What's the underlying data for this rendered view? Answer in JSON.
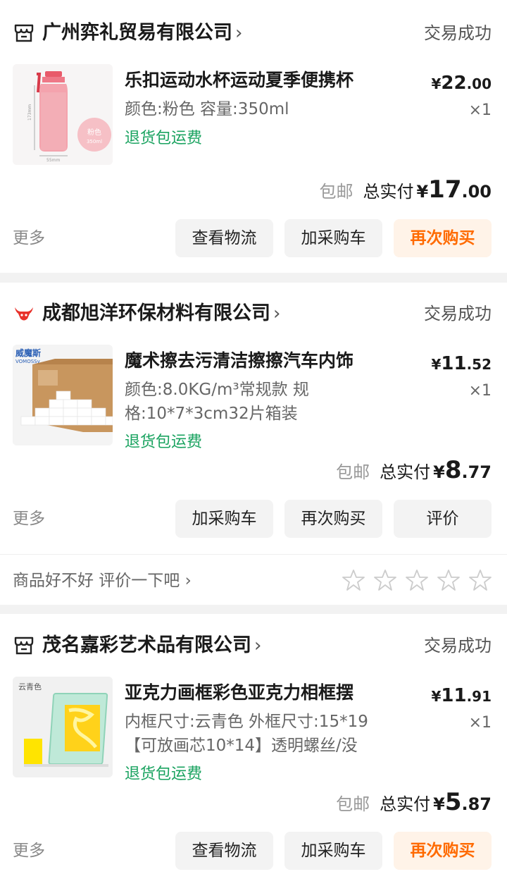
{
  "orders": [
    {
      "shop_name": "广州弈礼贸易有限公司",
      "shop_chevron": "›",
      "status": "交易成功",
      "product_title": "乐扣运动水杯运动夏季便携杯",
      "spec_line1": "颜色:粉色 容量:350ml",
      "tag": "退货包运费",
      "price_currency": "¥",
      "price_int": "22",
      "price_dec": ".00",
      "qty": "×1",
      "shipping": "包邮",
      "total_label": "总实付",
      "total_currency": "¥",
      "total_int": "17",
      "total_dec": ".00",
      "more": "更多",
      "buttons": [
        "查看物流",
        "加采购车",
        "再次购买"
      ],
      "thumb_badge": "粉色",
      "thumb_badge_sub": "350ml",
      "thumb_dim_h": "173mm",
      "thumb_dim_w": "55mm"
    },
    {
      "shop_name": "成都旭洋环保材料有限公司",
      "shop_chevron": "›",
      "status": "交易成功",
      "product_title": "魔术擦去污清洁擦擦汽车内饰",
      "spec_line1": "颜色:8.0KG/m³常规款 规",
      "spec_line2": "格:10*7*3cm32片箱装",
      "tag": "退货包运费",
      "price_currency": "¥",
      "price_int": "11",
      "price_dec": ".52",
      "qty": "×1",
      "shipping": "包邮",
      "total_label": "总实付",
      "total_currency": "¥",
      "total_int": "8",
      "total_dec": ".77",
      "more": "更多",
      "buttons": [
        "加采购车",
        "再次购买",
        "评价"
      ],
      "rate_prompt": "商品好不好 评价一下吧 ›",
      "thumb_brand": "威魔斯",
      "thumb_brand_sub": "VOMOSSy"
    },
    {
      "shop_name": "茂名嘉彩艺术品有限公司",
      "shop_chevron": "›",
      "status": "交易成功",
      "product_title": "亚克力画框彩色亚克力相框摆",
      "spec_line1": "内框尺寸:云青色 外框尺寸:15*19",
      "spec_line2": "【可放画芯10*14】透明螺丝/没",
      "tag": "退货包运费",
      "price_currency": "¥",
      "price_int": "11",
      "price_dec": ".91",
      "qty": "×1",
      "shipping": "包邮",
      "total_label": "总实付",
      "total_currency": "¥",
      "total_int": "5",
      "total_dec": ".87",
      "more": "更多",
      "buttons": [
        "查看物流",
        "加采购车",
        "再次购买"
      ],
      "thumb_caption": "云青色"
    }
  ],
  "colors": {
    "accent_orange": "#ff6a00",
    "accent_bg": "#fff3e8",
    "tag_green": "#1aa360",
    "shop_red_icon": "#e8322b"
  },
  "icons": {
    "shop1": "store-icon",
    "shop2": "bull-logo-icon",
    "shop3": "store-icon",
    "rating": "star-outline-icon"
  }
}
